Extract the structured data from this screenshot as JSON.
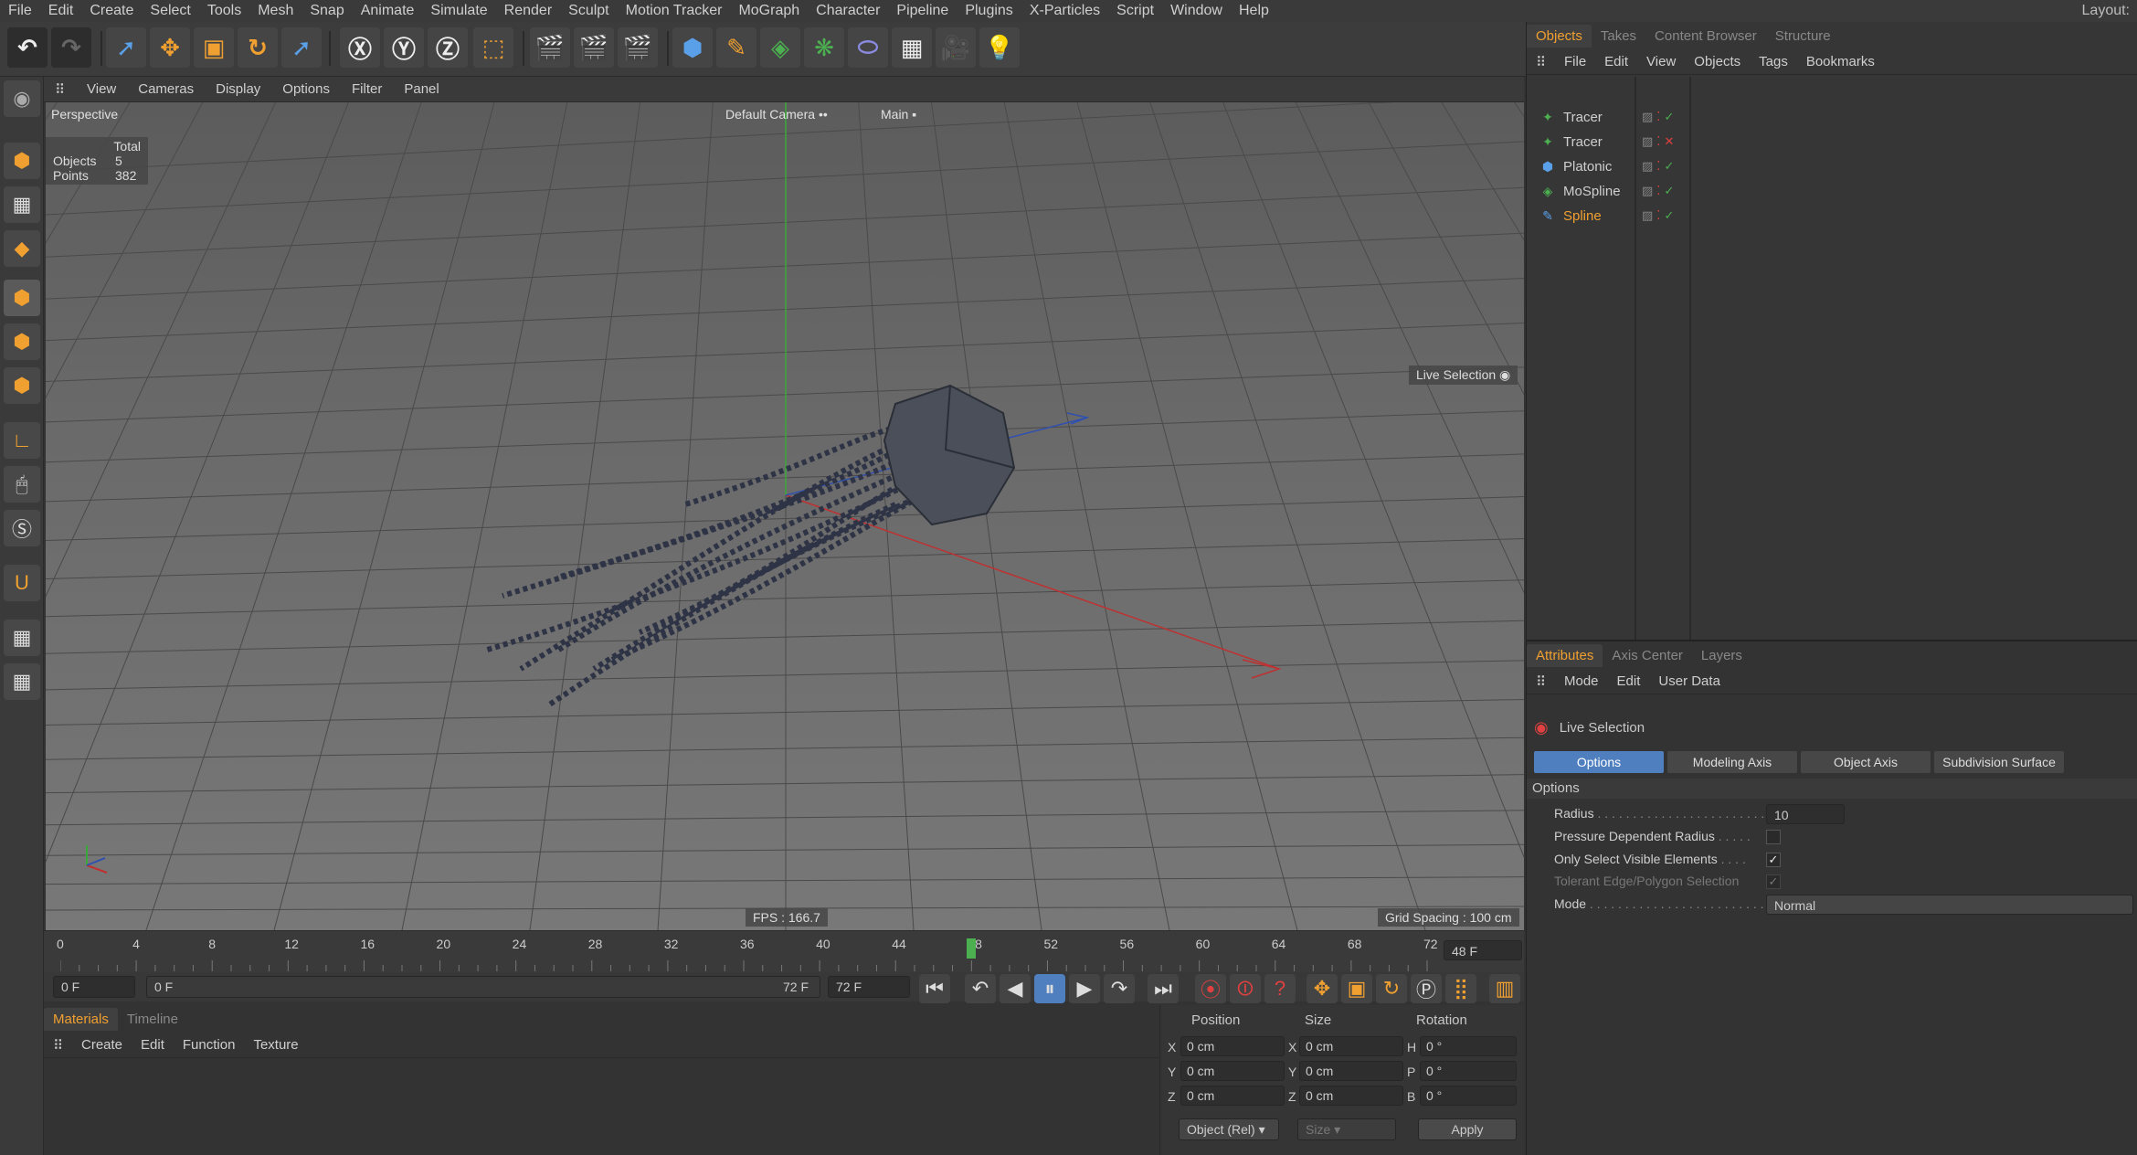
{
  "menubar": {
    "items": [
      "File",
      "Edit",
      "Create",
      "Select",
      "Tools",
      "Mesh",
      "Snap",
      "Animate",
      "Simulate",
      "Render",
      "Sculpt",
      "Motion Tracker",
      "MoGraph",
      "Character",
      "Pipeline",
      "Plugins",
      "X-Particles",
      "Script",
      "Window",
      "Help"
    ],
    "layout_label": "Layout:"
  },
  "viewport_menu": {
    "items": [
      "View",
      "Cameras",
      "Display",
      "Options",
      "Filter",
      "Panel"
    ]
  },
  "viewport": {
    "view_name": "Perspective",
    "camera": "Default Camera",
    "camera_suffix": "••",
    "take": "Main",
    "stats": {
      "total_label": "Total",
      "objects_label": "Objects",
      "objects_value": "5",
      "points_label": "Points",
      "points_value": "382"
    },
    "live_selection_label": "Live Selection",
    "fps": "FPS : 166.7",
    "grid_spacing": "Grid Spacing : 100 cm"
  },
  "timeline": {
    "ticks": [
      "0",
      "4",
      "8",
      "12",
      "16",
      "20",
      "24",
      "28",
      "32",
      "36",
      "40",
      "44",
      "48",
      "52",
      "56",
      "60",
      "64",
      "68",
      "72"
    ],
    "current_frame_display": "48 F",
    "current_frame": 48,
    "max_frame": 72
  },
  "transport": {
    "start_field": "0 F",
    "range_start": "0 F",
    "range_end": "72 F",
    "end_field": "72 F"
  },
  "materials": {
    "tabs": [
      "Materials",
      "Timeline"
    ],
    "menu": [
      "Create",
      "Edit",
      "Function",
      "Texture"
    ]
  },
  "coords": {
    "headers": [
      "Position",
      "Size",
      "Rotation"
    ],
    "rows": [
      {
        "axis": "X",
        "pos": "0 cm",
        "saxis": "X",
        "size": "0 cm",
        "raxis": "H",
        "rot": "0 °"
      },
      {
        "axis": "Y",
        "pos": "0 cm",
        "saxis": "Y",
        "size": "0 cm",
        "raxis": "P",
        "rot": "0 °"
      },
      {
        "axis": "Z",
        "pos": "0 cm",
        "saxis": "Z",
        "size": "0 cm",
        "raxis": "B",
        "rot": "0 °"
      }
    ],
    "mode_select": "Object (Rel)",
    "size_select": "Size",
    "apply_label": "Apply"
  },
  "objects_panel": {
    "tabs": [
      "Objects",
      "Takes",
      "Content Browser",
      "Structure"
    ],
    "menu": [
      "File",
      "Edit",
      "View",
      "Objects",
      "Tags",
      "Bookmarks"
    ],
    "objects": [
      {
        "name": "Tracer",
        "icon": "tracer-icon",
        "status": "✓",
        "status_color": "#4caf50",
        "highlight": false
      },
      {
        "name": "Tracer",
        "icon": "tracer-icon",
        "status": "✕",
        "status_color": "#e04040",
        "highlight": false
      },
      {
        "name": "Platonic",
        "icon": "platonic-icon",
        "status": "✓",
        "status_color": "#4caf50",
        "highlight": false
      },
      {
        "name": "MoSpline",
        "icon": "mospline-icon",
        "status": "✓",
        "status_color": "#4caf50",
        "highlight": false
      },
      {
        "name": "Spline",
        "icon": "spline-icon",
        "status": "✓",
        "status_color": "#4caf50",
        "highlight": true
      }
    ]
  },
  "attributes": {
    "tabs": [
      "Attributes",
      "Axis Center",
      "Layers"
    ],
    "menu": [
      "Mode",
      "Edit",
      "User Data"
    ],
    "tool_name": "Live Selection",
    "sub_tabs": [
      "Options",
      "Modeling Axis",
      "Object Axis",
      "Subdivision Surface"
    ],
    "section": "Options",
    "radius_label": "Radius",
    "radius_value": "10",
    "pressure_label": "Pressure Dependent Radius",
    "visible_label": "Only Select Visible Elements",
    "tolerant_label": "Tolerant Edge/Polygon Selection",
    "mode_label": "Mode",
    "mode_value": "Normal"
  },
  "colors": {
    "accent": "#f0a030",
    "active_tab": "#4f7fbf",
    "highlight_object": "#f0a030"
  }
}
